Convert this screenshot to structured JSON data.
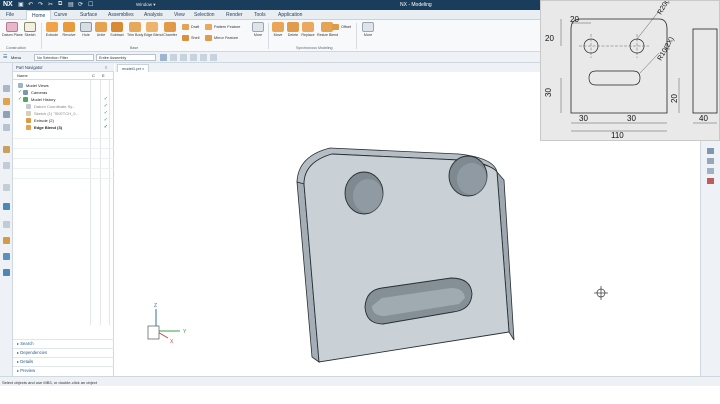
{
  "app": {
    "logo": "NX",
    "window_title": "NX - Modeling",
    "window_menu": "Window"
  },
  "menu_tabs": [
    "File",
    "Home",
    "Curve",
    "Surface",
    "Assemblies",
    "Analysis",
    "View",
    "Selection",
    "Render",
    "Tools",
    "Application"
  ],
  "ribbon": {
    "construction": {
      "group": "Construction",
      "datum_plane": "Datum Plane",
      "sketch": "Sketch"
    },
    "base_buttons": [
      "Extrude",
      "Revolve",
      "Hole",
      "Unite",
      "Subtract",
      "Trim Body",
      "Edge Blend",
      "Chamfer"
    ],
    "base_small": [
      "Draft",
      "Shell",
      "Pattern Feature",
      "Mirror Feature",
      "More"
    ],
    "base_group": "Base",
    "sync_buttons": [
      "Move",
      "Delete",
      "Replace",
      "Resize Blend",
      "Offset",
      "More"
    ],
    "sync_group": "Synchronous Modeling",
    "more_label": "More"
  },
  "selection": {
    "menu": "Menu",
    "filter": "No Selection Filter",
    "scope": "Entire Assembly"
  },
  "doc_tab": "model1.prt",
  "navigator": {
    "title": "Part Navigator",
    "columns": {
      "name": "Name",
      "c": "C",
      "e": "E"
    },
    "rows": [
      {
        "label": "Model Views"
      },
      {
        "label": "Cameras"
      },
      {
        "label": "Model History"
      },
      {
        "label": "Datum Coordinate Sy..."
      },
      {
        "label": "Sketch (1) \"SKETCH_0..."
      },
      {
        "label": "Extrude (2)"
      },
      {
        "label": "Edge Blend (3)"
      }
    ],
    "panels": [
      "Search",
      "Dependencies",
      "Details",
      "Preview"
    ]
  },
  "triad": {
    "x": "X",
    "y": "Y",
    "z": "Z"
  },
  "status_text": "Select objects and use MB3, or double-click an object",
  "drawing": {
    "dims": [
      "20",
      "20",
      "R20(2X)",
      "R10(2X)",
      "30",
      "20",
      "30",
      "30",
      "40",
      "110"
    ],
    "top_left_label": "20",
    "top_center_label": "20",
    "radius_large": "R20(2X)",
    "radius_small": "R10(2X)",
    "left_30": "30",
    "right_20": "20",
    "bottom_30a": "30",
    "bottom_30b": "30",
    "side_40": "40",
    "total_110": "110"
  },
  "colors": {
    "titlebar": "#1a3d5c",
    "accent": "#2a5c8a",
    "model": "#c9d1d7",
    "check": "#2e9a3a"
  }
}
